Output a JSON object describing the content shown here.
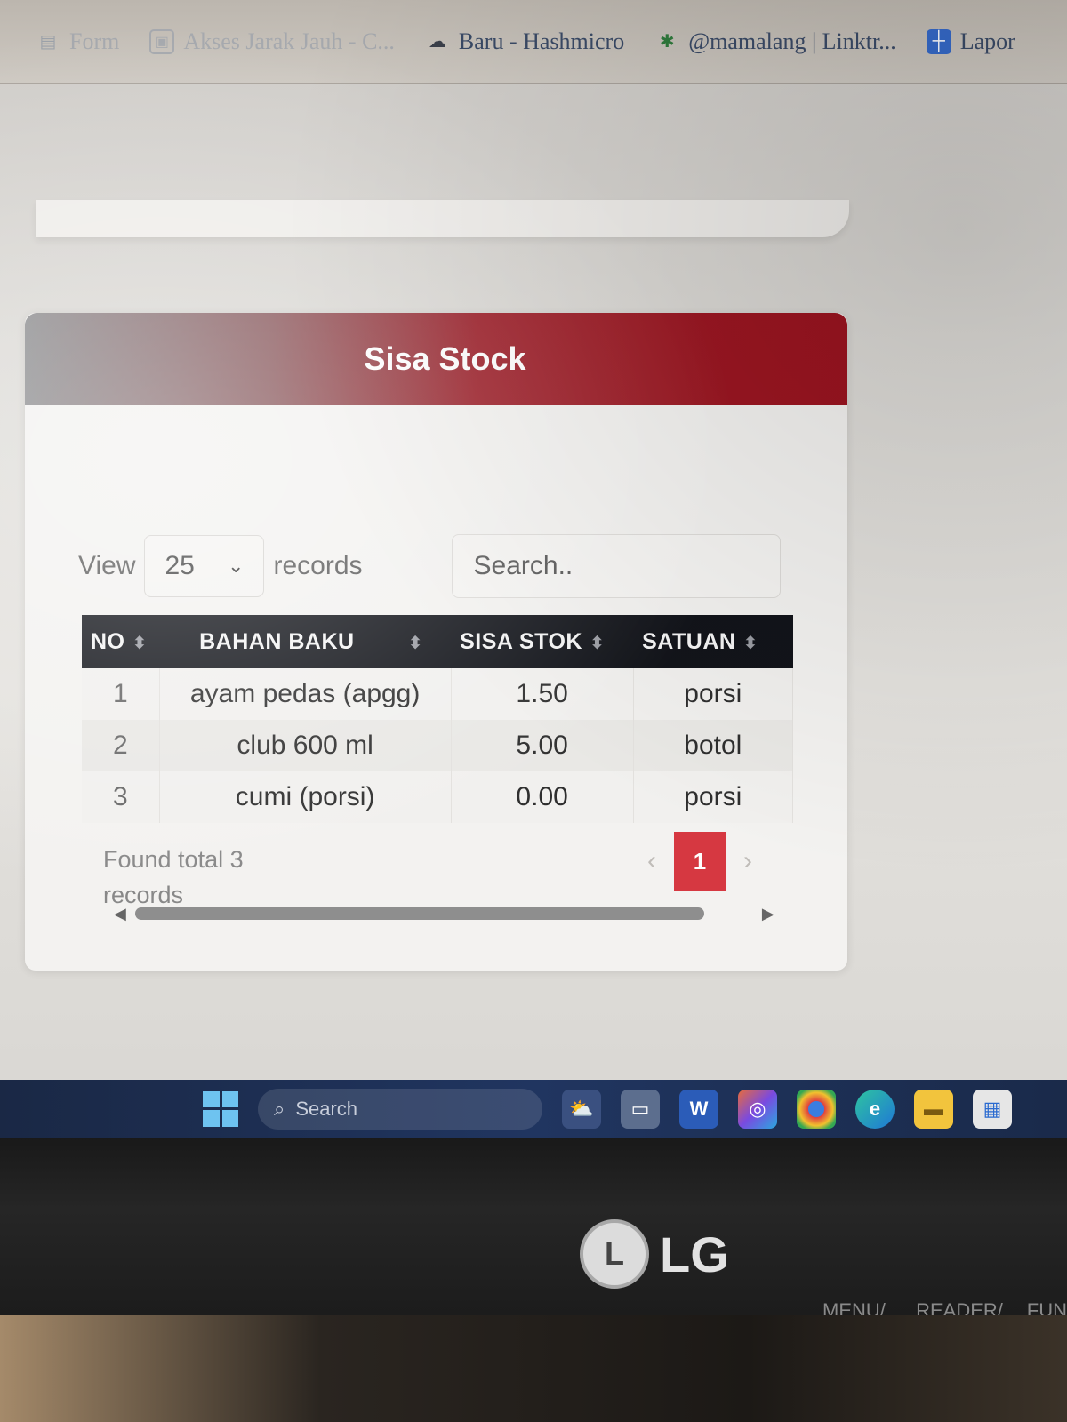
{
  "bookmarks": [
    {
      "label": "Form",
      "icon": "page-icon",
      "faded": true
    },
    {
      "label": "Akses Jarak Jauh - C...",
      "icon": "remote-icon",
      "faded": true
    },
    {
      "label": "Baru - Hashmicro",
      "icon": "cloud-icon",
      "faded": false
    },
    {
      "label": "@mamalang | Linktr...",
      "icon": "star-icon",
      "faded": false
    },
    {
      "label": "Lapor",
      "icon": "doc-icon",
      "faded": false
    }
  ],
  "card": {
    "title": "Sisa Stock"
  },
  "controls": {
    "view_label": "View",
    "records_label": "records",
    "page_size": "25",
    "search_placeholder": "Search.."
  },
  "table": {
    "columns": [
      "NO",
      "BAHAN BAKU",
      "SISA STOK",
      "SATUAN"
    ],
    "rows": [
      {
        "no": "1",
        "bahan": "ayam pedas (apgg)",
        "sisa": "1.50",
        "satuan": "porsi"
      },
      {
        "no": "2",
        "bahan": "club 600 ml",
        "sisa": "5.00",
        "satuan": "botol"
      },
      {
        "no": "3",
        "bahan": "cumi (porsi)",
        "sisa": "0.00",
        "satuan": "porsi"
      }
    ]
  },
  "footer": {
    "found_text": "Found total 3 records",
    "current_page": "1"
  },
  "taskbar": {
    "search_placeholder": "Search"
  },
  "monitor": {
    "brand": "LG",
    "buttons": [
      "MENU/⮠",
      "READER/◂",
      "FUN"
    ]
  },
  "colors": {
    "accent_red": "#9b1420",
    "page_active": "#d63841",
    "table_header": "#12141a"
  }
}
